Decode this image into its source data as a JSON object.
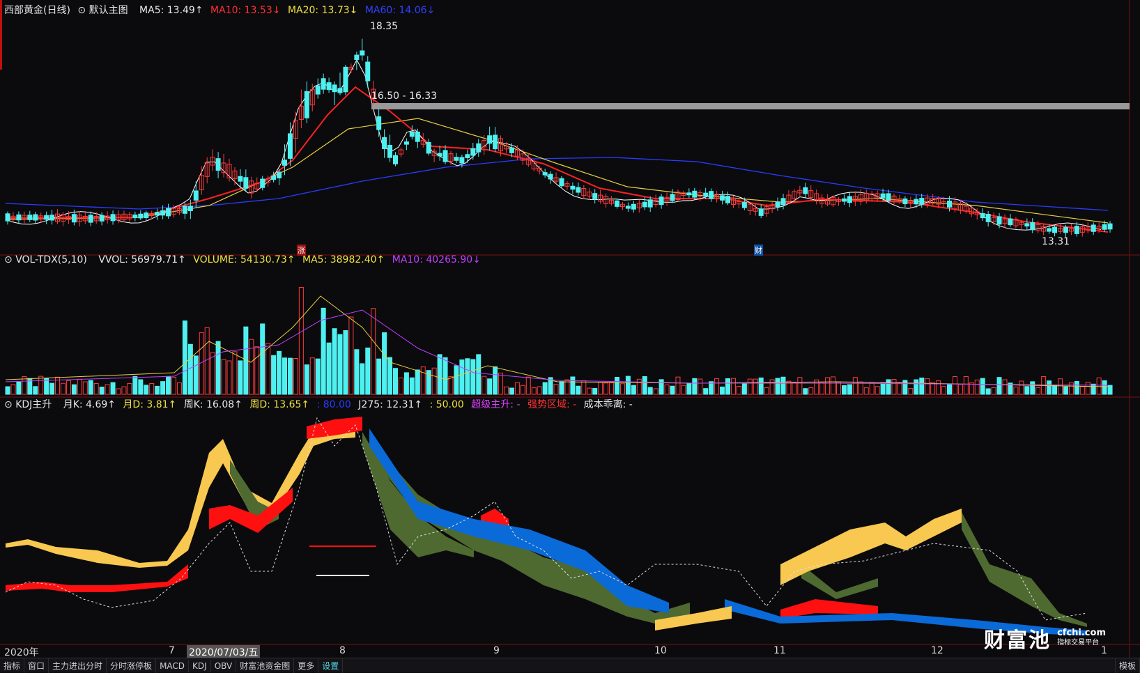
{
  "main_header": {
    "title": "西部黄金(日线)",
    "indicator": "默认主图",
    "ma5": "MA5: 13.49↑",
    "ma10": "MA10: 13.53↓",
    "ma20": "MA20: 13.73↓",
    "ma60": "MA60: 14.06↓"
  },
  "main_annotations": {
    "high": "18.35",
    "zone": "16.50 - 16.33",
    "low": "13.31"
  },
  "markers": {
    "rise": "涨",
    "finance": "财"
  },
  "vol_header": {
    "name": "VOL-TDX(5,10)",
    "vvol": "VVOL: 56979.71↑",
    "volume": "VOLUME: 54130.73↑",
    "ma5": "MA5: 38982.40↑",
    "ma10": "MA10: 40265.90↓"
  },
  "kdj_header": {
    "name": "KDJ主升",
    "mk": "月K: 4.69↑",
    "md": "月D: 3.81↑",
    "wk": "周K: 16.08↑",
    "wd": "周D: 13.65↑",
    "v80": ": 80.00",
    "j275": "J275: 12.31↑",
    "v50": ": 50.00",
    "super": "超级主升: -",
    "strong": "强势区域: -",
    "cost": "成本乖离: -"
  },
  "x_axis": {
    "year": "2020年",
    "m7": "7",
    "cursor_date": "2020/07/03/五",
    "m8": "8",
    "m9": "9",
    "m10": "10",
    "m11": "11",
    "m12": "12",
    "m1": "1"
  },
  "tabs": [
    "指标",
    "窗口",
    "主力进出分时",
    "分时涨停板",
    "MACD",
    "KDJ",
    "OBV",
    "财富池资金图",
    "更多",
    "设置"
  ],
  "corner_tab": "模板",
  "watermark": {
    "brand": "财富池",
    "site": "cfchi.com",
    "slogan": "指标交易平台"
  },
  "colors": {
    "up": "#ff3b3b",
    "down": "#4ef0f0",
    "ma5": "#ffffff",
    "ma10": "#ff2020",
    "ma20": "#e8d040",
    "ma60": "#2a3cff",
    "vol_ma5": "#e8d040",
    "vol_ma10": "#c040ff",
    "kdj_yellow": "#f8c850",
    "kdj_green": "#4e6a30",
    "kdj_red": "#ff1010",
    "kdj_blue": "#0a6ad8"
  }
}
